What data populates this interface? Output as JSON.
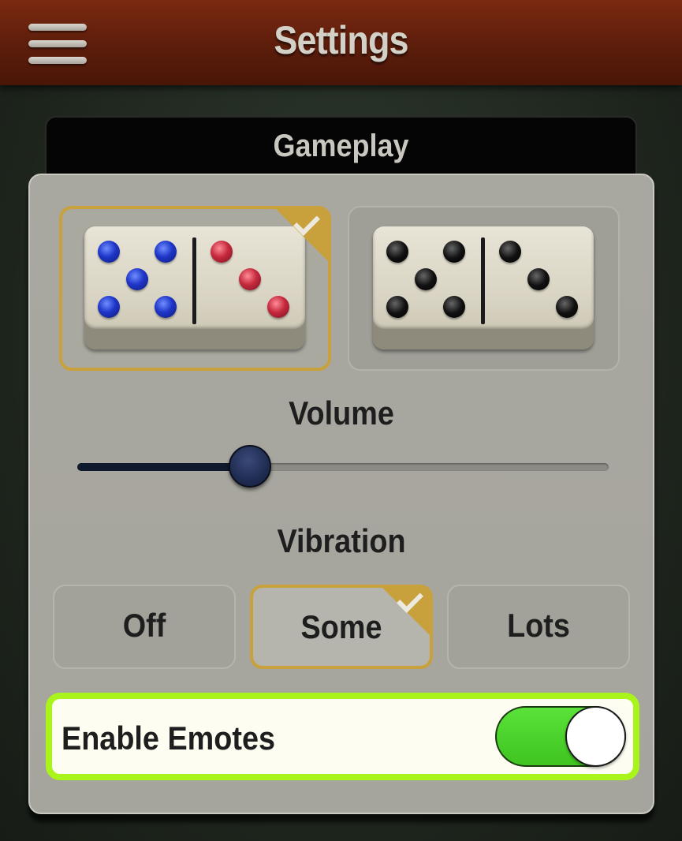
{
  "header": {
    "title": "Settings",
    "menu_icon": "hamburger-menu-icon"
  },
  "section": {
    "title": "Gameplay"
  },
  "domino_styles": {
    "options": [
      {
        "name": "colored",
        "pips": "5|3",
        "pip_colors": [
          "#1f36c8",
          "#c62a3d"
        ],
        "selected": true
      },
      {
        "name": "classic",
        "pips": "5|3",
        "pip_colors": [
          "#111111",
          "#111111"
        ],
        "selected": false
      }
    ],
    "selected_icon": "checkmark-icon"
  },
  "volume": {
    "label": "Volume",
    "value_fraction": 0.325
  },
  "vibration": {
    "label": "Vibration",
    "options": [
      "Off",
      "Some",
      "Lots"
    ],
    "selected": "Some"
  },
  "emotes": {
    "label": "Enable Emotes",
    "enabled": true
  },
  "colors": {
    "accent_gold": "#c9a13c",
    "highlight_green": "#a8f41b",
    "toggle_on": "#4fd62e",
    "header": "#5c1d0b"
  }
}
